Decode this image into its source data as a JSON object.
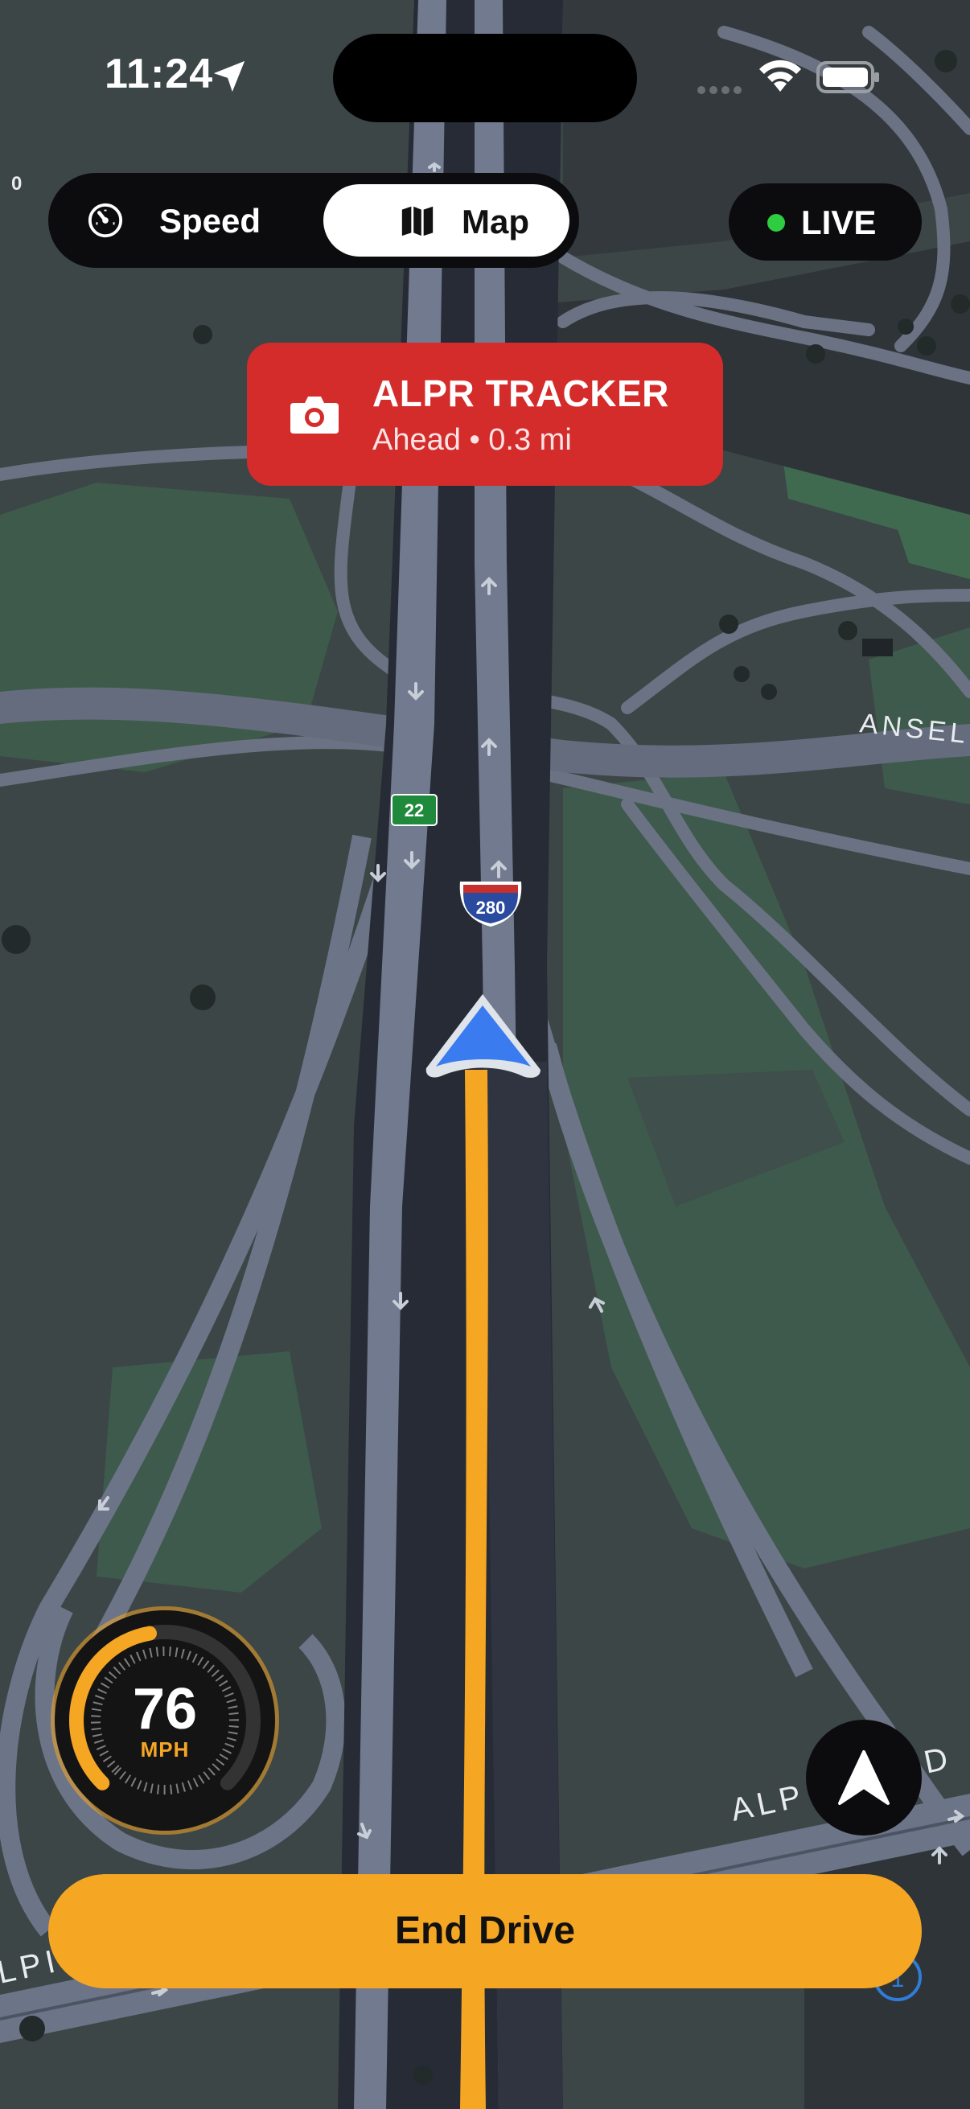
{
  "status_bar": {
    "time": "11:24",
    "location_icon": "location-arrow-icon",
    "wifi_icon": "wifi-icon",
    "battery_icon": "battery-icon"
  },
  "mode_toggle": {
    "speed_label": "Speed",
    "speed_icon": "gauge-icon",
    "map_label": "Map",
    "map_icon": "map-icon",
    "selected": "Map"
  },
  "live_badge": {
    "label": "LIVE",
    "dot_color": "#2ecc40"
  },
  "alert": {
    "title": "ALPR TRACKER",
    "subtitle": "Ahead • 0.3 mi",
    "icon": "camera-icon",
    "color": "#d42b2b"
  },
  "map": {
    "route_shield": "280",
    "exit_sign": "22",
    "street_ansel": "ANSEL",
    "street_alpine_top": "ALP",
    "street_alpine_rd": "RD",
    "street_alpine_left": "LPI",
    "edge_label": "0",
    "corner_marker": "1",
    "route_color": "#f5a623",
    "position_marker_color": "#3a7bf0"
  },
  "speedometer": {
    "value": "76",
    "unit": "MPH",
    "accent": "#f5a623"
  },
  "recenter": {
    "icon": "navigation-arrow-icon"
  },
  "end_drive": {
    "label": "End Drive",
    "color": "#f5a623"
  }
}
